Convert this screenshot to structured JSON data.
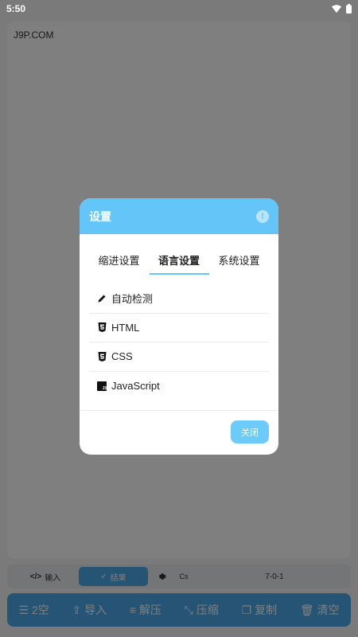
{
  "status": {
    "time": "5:50"
  },
  "editor": {
    "text": "J9P.COM"
  },
  "toolbar": {
    "input_label": "输入",
    "result_label": "结果",
    "cs_label": "Cs",
    "version": "7-0-1"
  },
  "actions": [
    {
      "label": "2空",
      "icon": "indent-icon"
    },
    {
      "label": "导入",
      "icon": "upload-icon"
    },
    {
      "label": "解压",
      "icon": "align-left-icon"
    },
    {
      "label": "压缩",
      "icon": "compress-icon"
    },
    {
      "label": "复制",
      "icon": "copy-icon"
    },
    {
      "label": "清空",
      "icon": "trash-icon"
    }
  ],
  "dialog": {
    "title": "设置",
    "tabs": [
      {
        "label": "缩进设置",
        "active": false
      },
      {
        "label": "语言设置",
        "active": true
      },
      {
        "label": "系统设置",
        "active": false
      }
    ],
    "languages": [
      {
        "label": "自动检测",
        "icon": "pencil-icon"
      },
      {
        "label": "HTML",
        "icon": "html5-icon"
      },
      {
        "label": "CSS",
        "icon": "css3-icon"
      },
      {
        "label": "JavaScript",
        "icon": "js-icon"
      }
    ],
    "close_label": "关闭"
  },
  "colors": {
    "accent": "#63c5f8",
    "action_bar": "#4aa9e8"
  }
}
